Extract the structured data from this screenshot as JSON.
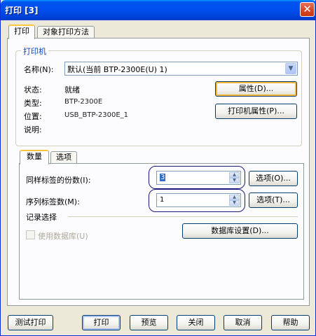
{
  "window": {
    "title": "打印 [3]",
    "close": "✕"
  },
  "tabs": [
    {
      "label": "打印"
    },
    {
      "label": "对象打印方法"
    }
  ],
  "printer": {
    "group_title": "打印机",
    "name_label": "名称(N):",
    "name_value": "默认(当前 BTP-2300E(U) 1)",
    "status_label": "状态:",
    "status_value": "就绪",
    "type_label": "类型:",
    "type_value": "BTP-2300E",
    "location_label": "位置:",
    "location_value": "USB_BTP-2300E_1",
    "comment_label": "说明:",
    "properties_button": "属性(D)...",
    "printer_properties_button": "打印机属性(P)..."
  },
  "inner_tabs": [
    {
      "label": "数量"
    },
    {
      "label": "选项"
    }
  ],
  "quantity": {
    "copies_label": "同样标签的份数(I):",
    "copies_value": "3",
    "copies_options_button": "选项(O)...",
    "serial_label": "序列标签数(M):",
    "serial_value": "1",
    "serial_options_button": "选项(T)...",
    "records_title": "记录选择",
    "use_database_label": "使用数据库(U)",
    "database_settings_button": "数据库设置(D)..."
  },
  "footer": {
    "test_print": "测试打印",
    "print": "打印",
    "preview": "预览",
    "close": "关闭",
    "cancel": "取消",
    "help": "帮助"
  }
}
